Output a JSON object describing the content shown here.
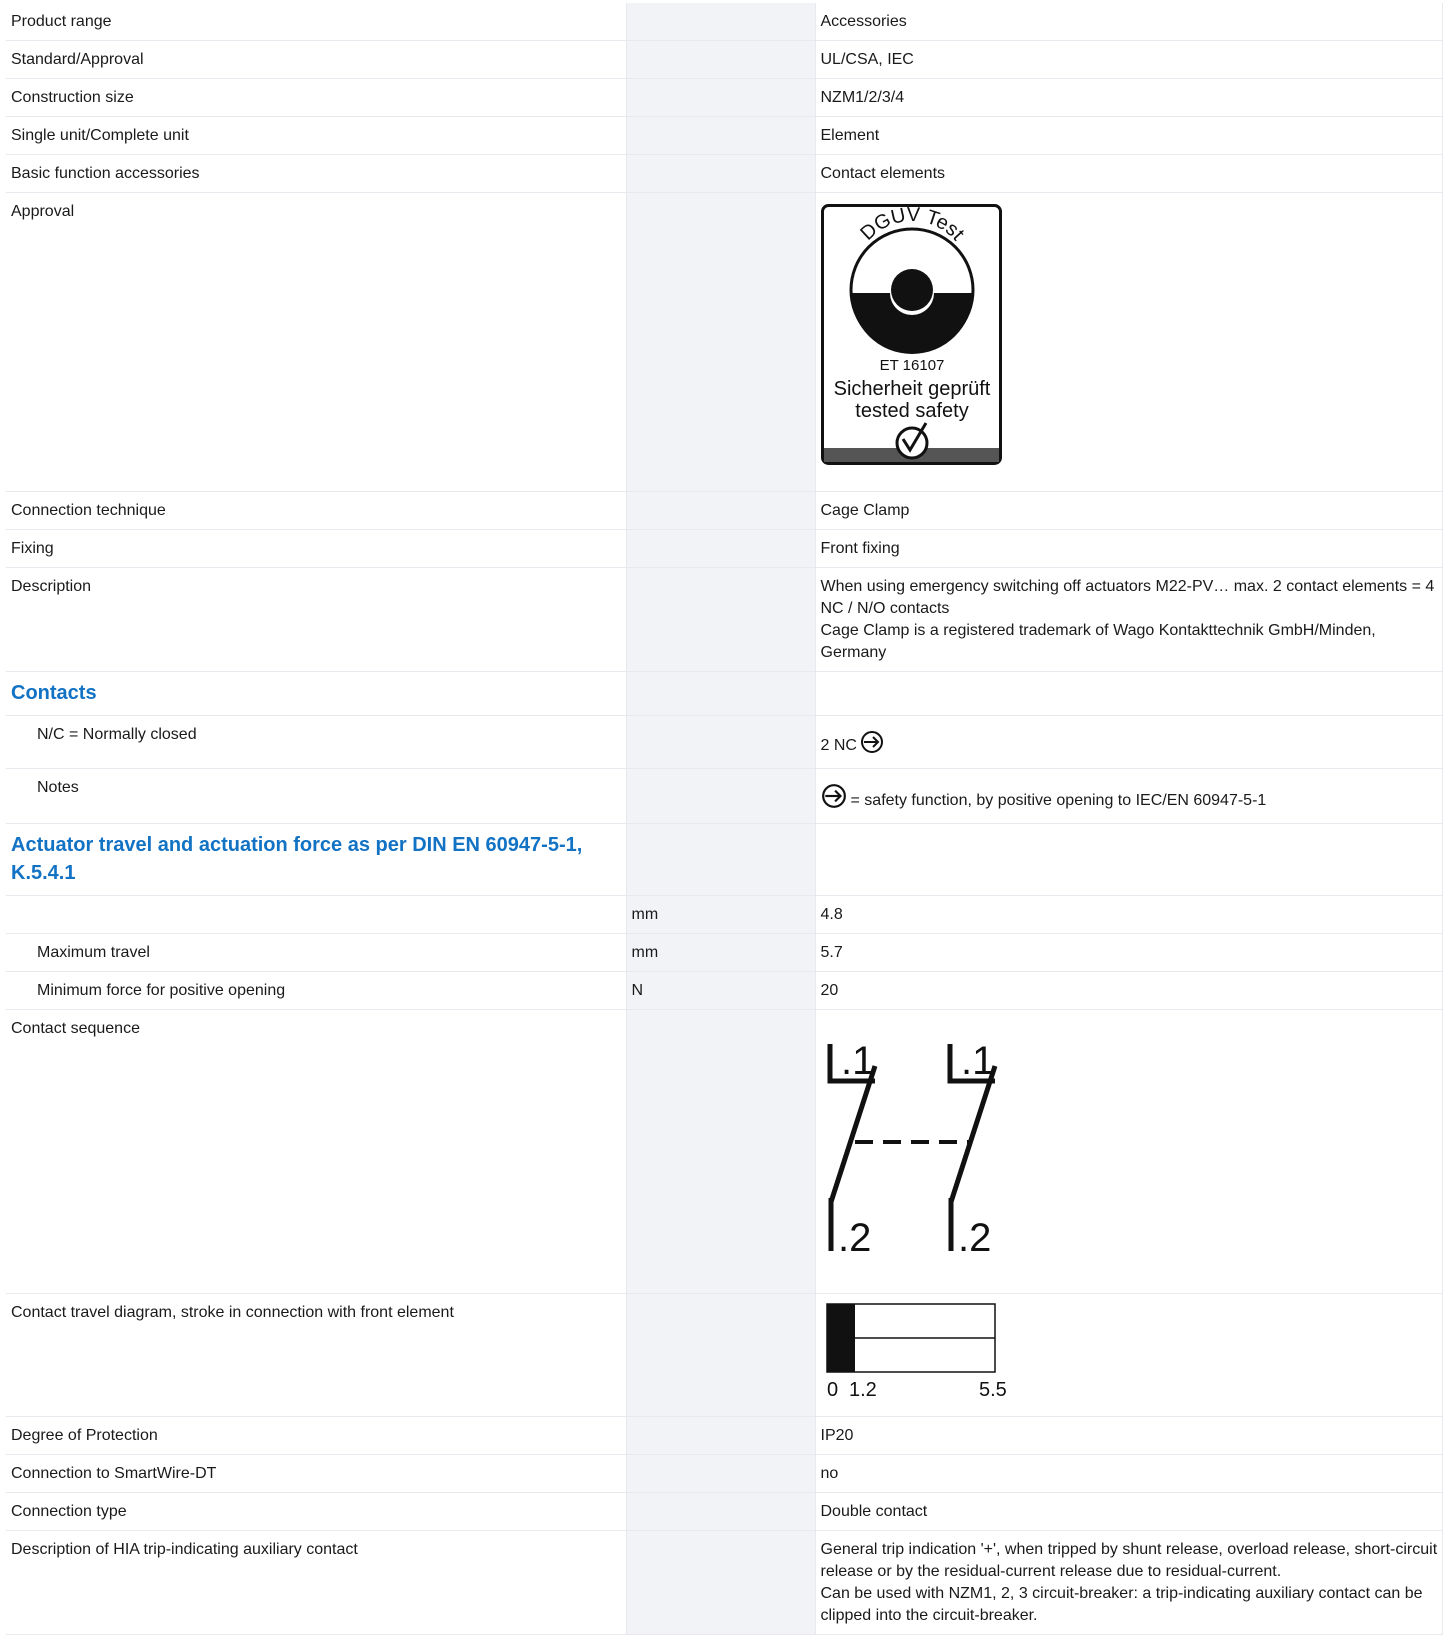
{
  "rows": {
    "product_range": {
      "label": "Product range",
      "value": "Accessories"
    },
    "standard_approval": {
      "label": "Standard/Approval",
      "value": "UL/CSA, IEC"
    },
    "construction_size": {
      "label": "Construction size",
      "value": "NZM1/2/3/4"
    },
    "single_complete": {
      "label": "Single unit/Complete unit",
      "value": "Element"
    },
    "basic_function": {
      "label": "Basic function accessories",
      "value": "Contact elements"
    },
    "approval": {
      "label": "Approval",
      "seal": {
        "top": "DGUV Test",
        "number": "ET 16107",
        "line1": "Sicherheit geprüft",
        "line2": "tested safety"
      }
    },
    "connection_technique": {
      "label": "Connection technique",
      "value": "Cage Clamp"
    },
    "fixing": {
      "label": "Fixing",
      "value": "Front fixing"
    },
    "description": {
      "label": "Description",
      "line1": "When using emergency switching off actuators M22-PV… max. 2 contact elements = 4 NC / N/O contacts",
      "line2": "Cage Clamp is a registered trademark of Wago Kontakttechnik GmbH/Minden, Germany"
    }
  },
  "contacts": {
    "heading": "Contacts",
    "nc": {
      "label": "N/C = Normally closed",
      "value": "2 NC",
      "icon": "positive-opening-icon"
    },
    "notes": {
      "label": "Notes",
      "value": "= safety function, by positive opening to IEC/EN 60947-5-1",
      "icon": "positive-opening-icon"
    }
  },
  "actuator": {
    "heading": "Actuator travel and actuation force as per DIN EN 60947-5-1, K.5.4.1",
    "row1": {
      "label": "",
      "unit": "mm",
      "value": "4.8"
    },
    "row2": {
      "label": "Maximum travel",
      "unit": "mm",
      "value": "5.7"
    },
    "row3": {
      "label": "Minimum force for positive opening",
      "unit": "N",
      "value": "20"
    }
  },
  "contact_sequence": {
    "label": "Contact sequence",
    "term_top": ".1",
    "term_bottom": ".2"
  },
  "travel_diagram": {
    "label": "Contact travel diagram, stroke in connection with front element",
    "ticks": [
      "0",
      "1.2",
      "5.5"
    ]
  },
  "rows2": {
    "degree_protection": {
      "label": "Degree of Protection",
      "value": "IP20"
    },
    "smartwire": {
      "label": "Connection to SmartWire-DT",
      "value": "no"
    },
    "connection_type": {
      "label": "Connection type",
      "value": "Double contact"
    },
    "hia": {
      "label": "Description of HIA trip-indicating auxiliary contact",
      "line1": "General trip indication '+', when tripped by shunt release, overload release, short-circuit release or by the residual-current release due to residual-current.",
      "line2": "Can be used with NZM1, 2, 3 circuit-breaker: a trip-indicating auxiliary contact can be clipped into the circuit-breaker."
    }
  }
}
